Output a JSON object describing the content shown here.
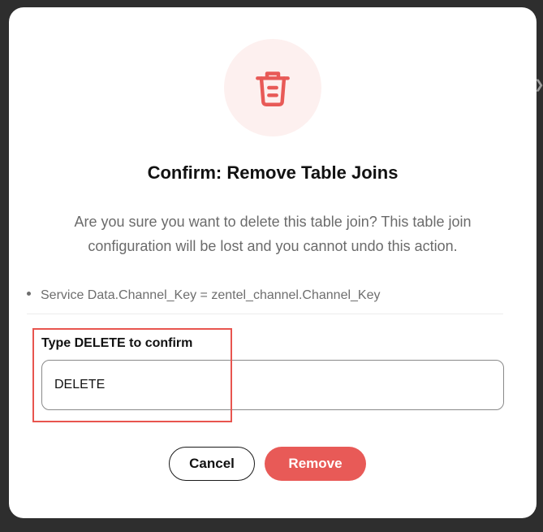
{
  "dialog": {
    "title": "Confirm: Remove Table Joins",
    "description": "Are you sure you want to delete this table join? This table join configuration will be lost and you cannot undo this action.",
    "icon": "trash-icon",
    "joins": [
      "Service Data.Channel_Key = zentel_channel.Channel_Key"
    ],
    "confirm_label": "Type DELETE to confirm",
    "confirm_value": "DELETE",
    "cancel_label": "Cancel",
    "remove_label": "Remove"
  },
  "colors": {
    "accent": "#e85a57",
    "icon_bg": "#fdf0ef",
    "highlight": "#e8554f"
  }
}
